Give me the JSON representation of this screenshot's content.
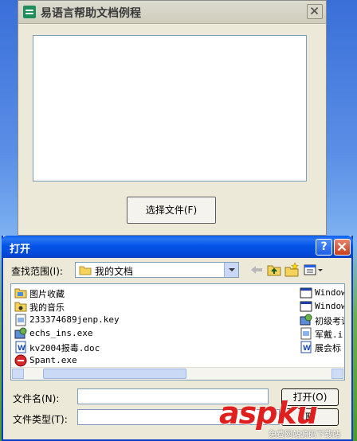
{
  "app_window": {
    "title": "易语言帮助文档例程",
    "button_label": "选择文件(F)"
  },
  "dialog": {
    "title": "打开",
    "help_glyph": "?",
    "look_in_label": "查找范围(I):",
    "look_in_value": "我的文档",
    "files_left": [
      {
        "name": "图片收藏",
        "icon": "folder-icon"
      },
      {
        "name": "我的音乐",
        "icon": "folder-icon"
      },
      {
        "name": "233374689jenp.key",
        "icon": "file-icon"
      },
      {
        "name": "echs_ins.exe",
        "icon": "exe-icon"
      },
      {
        "name": "kv2004报毒.doc",
        "icon": "doc-icon"
      },
      {
        "name": "Spant.exe",
        "icon": "red-exe-icon"
      }
    ],
    "files_right": [
      {
        "name": "Windows",
        "icon": "window-icon"
      },
      {
        "name": "Windows",
        "icon": "window-icon"
      },
      {
        "name": "初级考试",
        "icon": "exe-icon"
      },
      {
        "name": "军戴.i",
        "icon": "file-icon"
      },
      {
        "name": "展会标",
        "icon": "doc-icon"
      }
    ],
    "file_name_label": "文件名(N):",
    "file_type_label": "文件类型(T):",
    "file_name_value": "",
    "file_type_value": "",
    "open_label": "打开(O)",
    "cancel_label": "取"
  },
  "watermark": {
    "main": "aspku",
    "sub": "免费网站源码下载站"
  },
  "colors": {
    "dialog_title_blue": "#0554e8",
    "close_red": "#c8401c",
    "watermark_red": "#e01f1f"
  }
}
